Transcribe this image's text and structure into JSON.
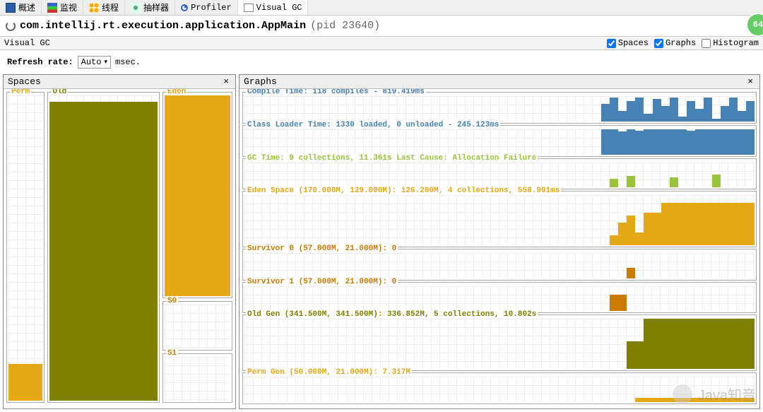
{
  "tabs": [
    "概述",
    "监视",
    "线程",
    "抽样器",
    "Profiler",
    "Visual GC"
  ],
  "title_class": "com.intellij.rt.execution.application.AppMain",
  "title_pid": "(pid 23640)",
  "panel_name": "Visual GC",
  "checks": {
    "spaces": "Spaces",
    "graphs": "Graphs",
    "histogram": "Histogram"
  },
  "refresh_label": "Refresh rate:",
  "refresh_value": "Auto",
  "refresh_unit": "msec.",
  "spaces_title": "Spaces",
  "graphs_title": "Graphs",
  "spaces": {
    "perm": {
      "label": "Perm",
      "fill": 12
    },
    "old": {
      "label": "Old",
      "fill": 98
    },
    "eden": {
      "label": "Eden",
      "fill": 100
    },
    "s0": {
      "label": "S0",
      "fill": 0
    },
    "s1": {
      "label": "S1",
      "fill": 0
    }
  },
  "graphs": [
    {
      "id": "compile",
      "color": "c-steel",
      "fill": "fill-steel",
      "label": "Compile Time: 118 compiles - 819.419ms",
      "size": "short",
      "bars": [
        0,
        0,
        0,
        0,
        0,
        0,
        0,
        0,
        0,
        0,
        0,
        0,
        0,
        0,
        0,
        0,
        0,
        0,
        0,
        0,
        0,
        0,
        0,
        0,
        0,
        0,
        0,
        0,
        0,
        0,
        0,
        0,
        0,
        0,
        0,
        0,
        0,
        0,
        0,
        0,
        0,
        0,
        70,
        95,
        40,
        80,
        95,
        30,
        90,
        60,
        95,
        20,
        80,
        50,
        95,
        10,
        60,
        95,
        40,
        80
      ]
    },
    {
      "id": "classloader",
      "color": "c-steel",
      "fill": "fill-steel",
      "label": "Class Loader Time: 1330 loaded, 0 unloaded - 245.123ms",
      "size": "short",
      "bars": [
        0,
        0,
        0,
        0,
        0,
        0,
        0,
        0,
        0,
        0,
        0,
        0,
        0,
        0,
        0,
        0,
        0,
        0,
        0,
        0,
        0,
        0,
        0,
        0,
        0,
        0,
        0,
        0,
        0,
        0,
        0,
        0,
        0,
        0,
        0,
        0,
        0,
        0,
        0,
        0,
        0,
        0,
        100,
        100,
        90,
        100,
        95,
        100,
        98,
        100,
        100,
        100,
        95,
        100,
        100,
        100,
        100,
        100,
        100,
        100
      ]
    },
    {
      "id": "gc",
      "color": "c-green",
      "fill": "fill-green",
      "label": "GC Time: 9 collections, 11.361s  Last Cause: Allocation Failure",
      "size": "short",
      "bars": [
        0,
        0,
        0,
        0,
        0,
        0,
        0,
        0,
        0,
        0,
        0,
        0,
        0,
        0,
        0,
        0,
        0,
        0,
        0,
        0,
        0,
        0,
        0,
        0,
        0,
        0,
        0,
        0,
        0,
        0,
        0,
        0,
        0,
        0,
        0,
        0,
        0,
        0,
        0,
        0,
        0,
        0,
        0,
        35,
        0,
        45,
        0,
        0,
        0,
        0,
        40,
        0,
        0,
        0,
        0,
        50,
        0,
        0,
        0,
        0
      ]
    },
    {
      "id": "eden",
      "color": "c-orange",
      "fill": "fill-eden",
      "label": "Eden Space (170.000M, 129.000M): 126.280M, 4 collections, 558.991ms",
      "size": "",
      "bars": [
        0,
        0,
        0,
        0,
        0,
        0,
        0,
        0,
        0,
        0,
        0,
        0,
        0,
        0,
        0,
        0,
        0,
        0,
        0,
        0,
        0,
        0,
        0,
        0,
        0,
        0,
        0,
        0,
        0,
        0,
        0,
        0,
        0,
        0,
        0,
        0,
        0,
        0,
        0,
        0,
        0,
        0,
        0,
        20,
        45,
        60,
        25,
        65,
        65,
        85,
        85,
        85,
        85,
        85,
        85,
        85,
        85,
        85,
        85,
        85
      ]
    },
    {
      "id": "s0",
      "color": "c-dorange",
      "fill": "fill-s1",
      "label": "Survivor 0 (57.000M, 21.000M): 0",
      "size": "short",
      "bars": [
        0,
        0,
        0,
        0,
        0,
        0,
        0,
        0,
        0,
        0,
        0,
        0,
        0,
        0,
        0,
        0,
        0,
        0,
        0,
        0,
        0,
        0,
        0,
        0,
        0,
        0,
        0,
        0,
        0,
        0,
        0,
        0,
        0,
        0,
        0,
        0,
        0,
        0,
        0,
        0,
        0,
        0,
        0,
        0,
        0,
        40,
        0,
        0,
        0,
        0,
        0,
        0,
        0,
        0,
        0,
        0,
        0,
        0,
        0,
        0
      ]
    },
    {
      "id": "s1",
      "color": "c-dorange",
      "fill": "fill-s1",
      "label": "Survivor 1 (57.000M, 21.000M): 0",
      "size": "short",
      "bars": [
        0,
        0,
        0,
        0,
        0,
        0,
        0,
        0,
        0,
        0,
        0,
        0,
        0,
        0,
        0,
        0,
        0,
        0,
        0,
        0,
        0,
        0,
        0,
        0,
        0,
        0,
        0,
        0,
        0,
        0,
        0,
        0,
        0,
        0,
        0,
        0,
        0,
        0,
        0,
        0,
        0,
        0,
        0,
        65,
        65,
        0,
        0,
        0,
        0,
        0,
        0,
        0,
        0,
        0,
        0,
        0,
        0,
        0,
        0,
        0
      ]
    },
    {
      "id": "oldgen",
      "color": "c-olive",
      "fill": "fill-old",
      "label": "Old Gen (341.500M, 341.500M): 336.852M, 5 collections, 10.802s",
      "size": "",
      "bars": [
        0,
        0,
        0,
        0,
        0,
        0,
        0,
        0,
        0,
        0,
        0,
        0,
        0,
        0,
        0,
        0,
        0,
        0,
        0,
        0,
        0,
        0,
        0,
        0,
        0,
        0,
        0,
        0,
        0,
        0,
        0,
        0,
        0,
        0,
        0,
        0,
        0,
        0,
        0,
        0,
        0,
        0,
        0,
        0,
        0,
        55,
        55,
        100,
        100,
        100,
        100,
        100,
        100,
        100,
        100,
        100,
        100,
        100,
        100,
        100
      ]
    },
    {
      "id": "permgen",
      "color": "c-orange",
      "fill": "fill-perm",
      "label": "Perm Gen (50.000M, 21.000M): 7.317M",
      "size": "short",
      "bars": [
        0,
        0,
        0,
        0,
        0,
        0,
        0,
        0,
        0,
        0,
        0,
        0,
        0,
        0,
        0,
        0,
        0,
        0,
        0,
        0,
        0,
        0,
        0,
        0,
        0,
        0,
        0,
        0,
        0,
        0,
        0,
        0,
        0,
        0,
        0,
        0,
        0,
        0,
        0,
        0,
        0,
        0,
        0,
        0,
        0,
        0,
        18,
        18,
        18,
        18,
        18,
        18,
        18,
        18,
        18,
        18,
        18,
        18,
        18,
        18
      ]
    }
  ],
  "watermark": "Java知音",
  "badge": "64",
  "chart_data": {
    "spaces": [
      {
        "name": "Perm",
        "value_pct": 12,
        "color": "#e6a817"
      },
      {
        "name": "Old",
        "value_pct": 98,
        "color": "#808000"
      },
      {
        "name": "Eden",
        "value_pct": 100,
        "color": "#e6a817"
      },
      {
        "name": "S0",
        "value_pct": 0,
        "color": "#cc7a00"
      },
      {
        "name": "S1",
        "value_pct": 0,
        "color": "#cc7a00"
      }
    ],
    "timeline_graphs": [
      {
        "name": "Compile Time",
        "compiles": 118,
        "time_ms": 819.419
      },
      {
        "name": "Class Loader Time",
        "loaded": 1330,
        "unloaded": 0,
        "time_ms": 245.123
      },
      {
        "name": "GC Time",
        "collections": 9,
        "time_s": 11.361,
        "last_cause": "Allocation Failure"
      },
      {
        "name": "Eden Space",
        "capacity_m": 170.0,
        "used_cap_m": 129.0,
        "used_m": 126.28,
        "collections": 4,
        "time_ms": 558.991
      },
      {
        "name": "Survivor 0",
        "capacity_m": 57.0,
        "used_cap_m": 21.0,
        "used_m": 0
      },
      {
        "name": "Survivor 1",
        "capacity_m": 57.0,
        "used_cap_m": 21.0,
        "used_m": 0
      },
      {
        "name": "Old Gen",
        "capacity_m": 341.5,
        "used_cap_m": 341.5,
        "used_m": 336.852,
        "collections": 5,
        "time_s": 10.802
      },
      {
        "name": "Perm Gen",
        "capacity_m": 50.0,
        "used_cap_m": 21.0,
        "used_m": 7.317
      }
    ]
  }
}
